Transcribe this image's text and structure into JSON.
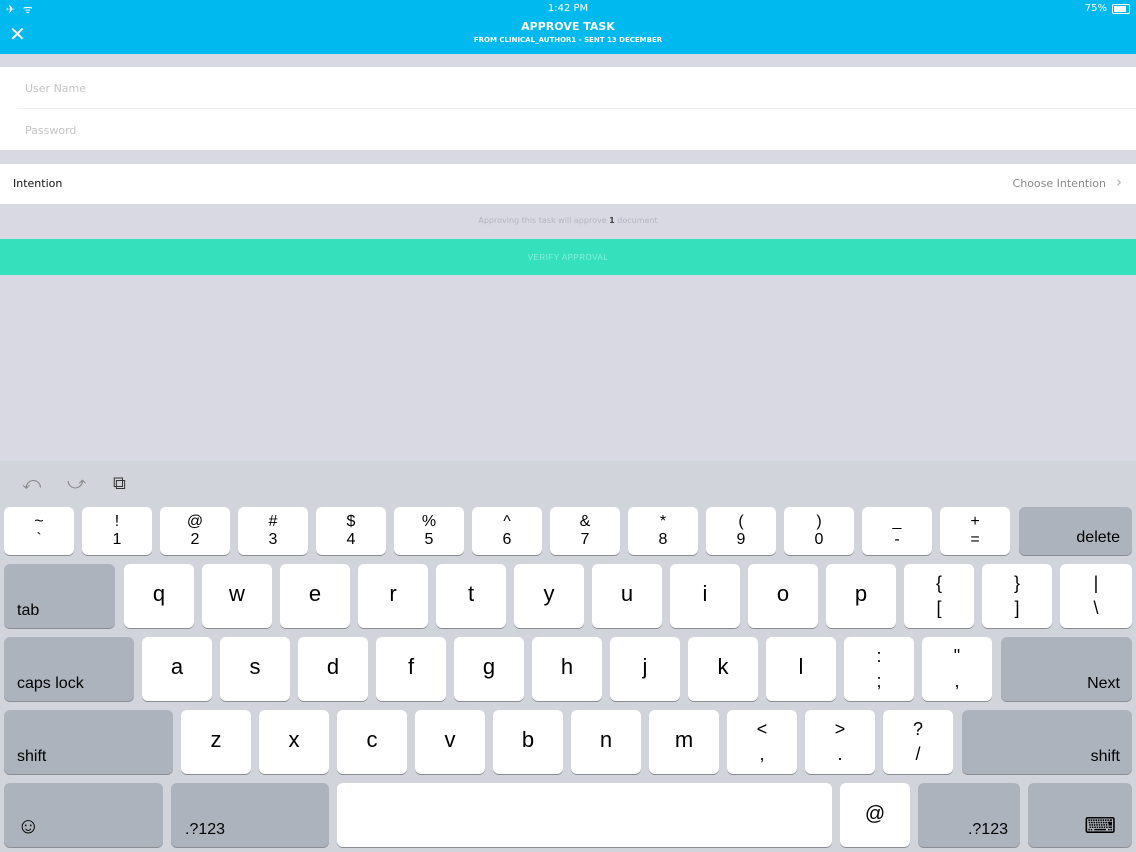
{
  "status": {
    "time": "1:42 PM",
    "battery": "75%",
    "left_icons": "✈ ᯤ"
  },
  "nav": {
    "title": "APPROVE TASK",
    "subtitle": "FROM CLINICAL_AUTHOR1 - SENT 13 DECEMBER",
    "close": "✕"
  },
  "form": {
    "username_placeholder": "User Name",
    "password_placeholder": "Password"
  },
  "intention": {
    "label": "Intention",
    "value": "Choose Intention",
    "chevron": "›"
  },
  "info": {
    "prefix": "Approving this task will approve ",
    "count": "1",
    "suffix": " document"
  },
  "verify_label": "VERIFY APPROVAL",
  "toolbar": {
    "undo": "⤺",
    "redo": "⤻",
    "copy": "⧉"
  },
  "keys": {
    "num": [
      [
        "~",
        "`"
      ],
      [
        "!",
        "1"
      ],
      [
        "@",
        "2"
      ],
      [
        "#",
        "3"
      ],
      [
        "$",
        "4"
      ],
      [
        "%",
        "5"
      ],
      [
        "^",
        "6"
      ],
      [
        "&",
        "7"
      ],
      [
        "*",
        "8"
      ],
      [
        "(",
        "9"
      ],
      [
        ")",
        "0"
      ],
      [
        "_",
        "-"
      ],
      [
        "+",
        "="
      ]
    ],
    "delete": "delete",
    "tab": "tab",
    "row2": [
      "q",
      "w",
      "e",
      "r",
      "t",
      "y",
      "u",
      "i",
      "o",
      "p"
    ],
    "row2_pairs": [
      [
        "{",
        "["
      ],
      [
        "}",
        "]"
      ],
      [
        "|",
        "\\"
      ]
    ],
    "caps": "caps lock",
    "row3": [
      "a",
      "s",
      "d",
      "f",
      "g",
      "h",
      "j",
      "k",
      "l"
    ],
    "row3_pairs": [
      [
        ":",
        ";"
      ],
      [
        "\"",
        ","
      ]
    ],
    "next": "Next",
    "shift": "shift",
    "row4": [
      "z",
      "x",
      "c",
      "v",
      "b",
      "n",
      "m"
    ],
    "row4_pairs": [
      [
        "<",
        ","
      ],
      [
        ">",
        "."
      ],
      [
        "?",
        "/"
      ]
    ],
    "emoji": "☺",
    "sym": ".?123",
    "at": "@",
    "kb": "⌨"
  }
}
